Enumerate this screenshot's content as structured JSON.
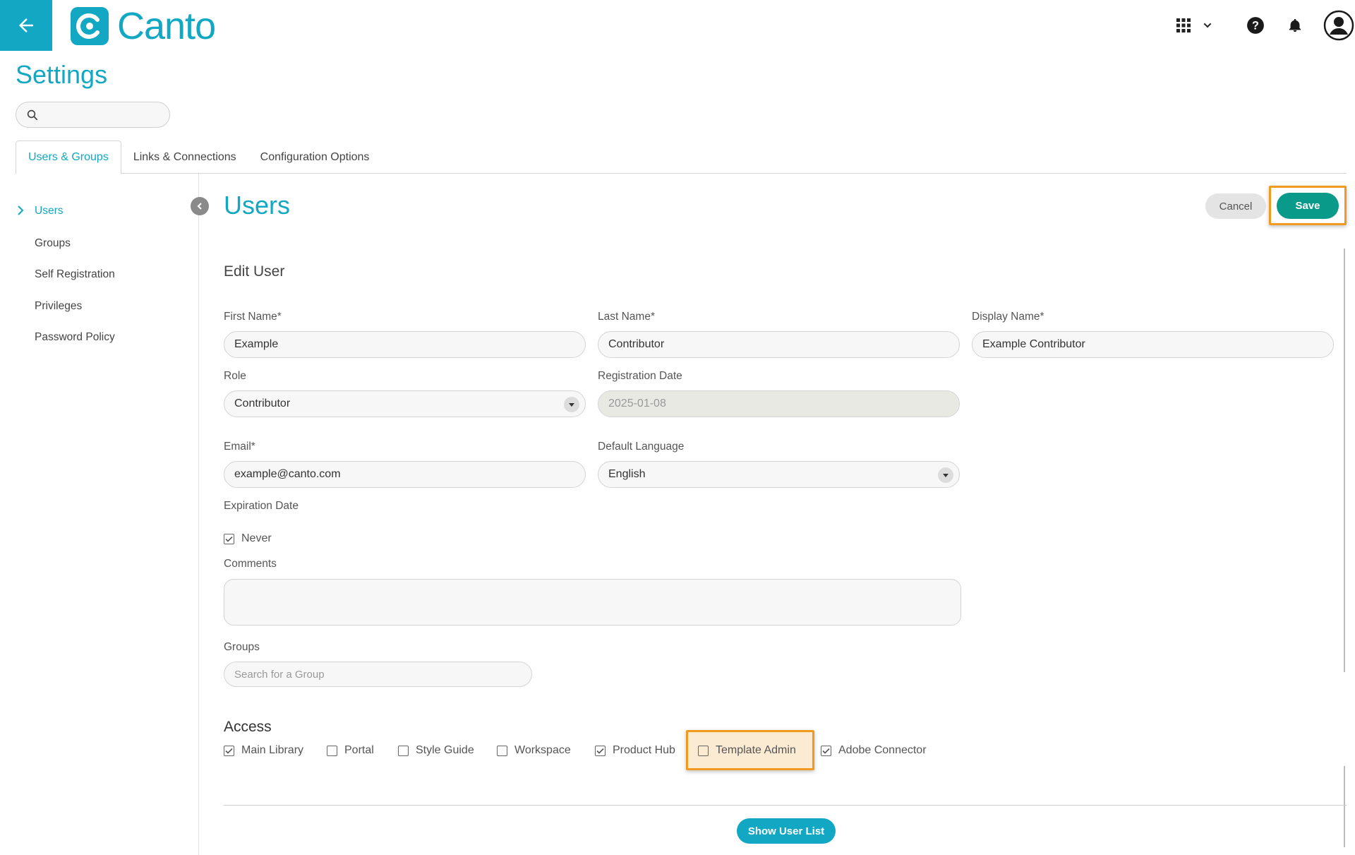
{
  "app": {
    "brand": "Canto",
    "accent": "#12a8c4",
    "save_color": "#0a9a8a",
    "highlight_color": "#f19a20"
  },
  "header": {
    "icons": [
      "back-arrow-icon",
      "apps-grid-icon",
      "chevron-down-icon",
      "help-icon",
      "bell-icon",
      "user-avatar-icon"
    ]
  },
  "page": {
    "title": "Settings",
    "search_placeholder": ""
  },
  "tabs": [
    {
      "label": "Users & Groups",
      "active": true
    },
    {
      "label": "Links & Connections",
      "active": false
    },
    {
      "label": "Configuration Options",
      "active": false
    }
  ],
  "sidebar": {
    "items": [
      {
        "label": "Users",
        "active": true
      },
      {
        "label": "Groups",
        "active": false
      },
      {
        "label": "Self Registration",
        "active": false
      },
      {
        "label": "Privileges",
        "active": false
      },
      {
        "label": "Password Policy",
        "active": false
      }
    ]
  },
  "main": {
    "title": "Users",
    "cancel_label": "Cancel",
    "save_label": "Save",
    "section_title": "Edit User",
    "fields": {
      "first_name": {
        "label": "First Name*",
        "value": "Example"
      },
      "last_name": {
        "label": "Last Name*",
        "value": "Contributor"
      },
      "display_name": {
        "label": "Display Name*",
        "value": "Example Contributor"
      },
      "role": {
        "label": "Role",
        "value": "Contributor"
      },
      "registration_date": {
        "label": "Registration Date",
        "value": "2025-01-08"
      },
      "email": {
        "label": "Email*",
        "value": "example@canto.com"
      },
      "default_language": {
        "label": "Default Language",
        "value": "English"
      },
      "expiration_date": {
        "label": "Expiration Date",
        "never_label": "Never",
        "never_checked": true
      },
      "comments": {
        "label": "Comments",
        "value": ""
      },
      "groups": {
        "label": "Groups",
        "placeholder": "Search for a Group"
      }
    },
    "access": {
      "title": "Access",
      "options": [
        {
          "label": "Main Library",
          "checked": true
        },
        {
          "label": "Portal",
          "checked": false
        },
        {
          "label": "Style Guide",
          "checked": false
        },
        {
          "label": "Workspace",
          "checked": false
        },
        {
          "label": "Product Hub",
          "checked": true
        },
        {
          "label": "Template Admin",
          "checked": false,
          "highlighted": true
        },
        {
          "label": "Adobe Connector",
          "checked": true
        }
      ]
    },
    "show_user_list_label": "Show User List"
  }
}
